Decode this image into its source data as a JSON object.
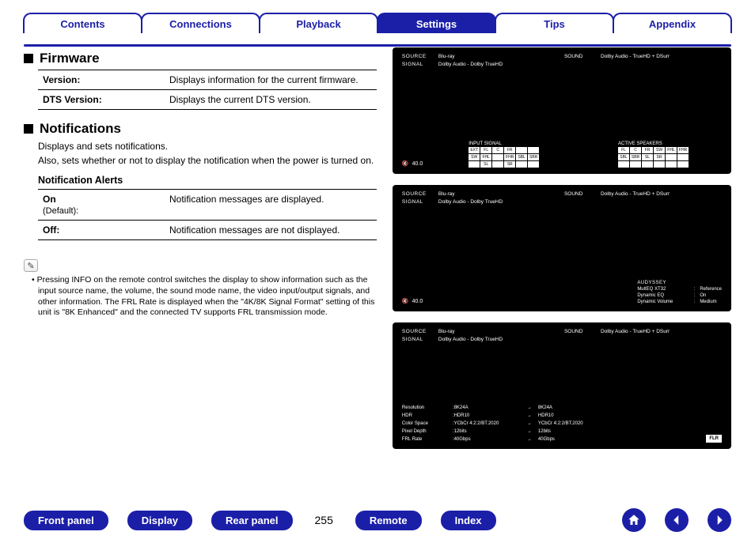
{
  "tabs": {
    "contents": "Contents",
    "connections": "Connections",
    "playback": "Playback",
    "settings": "Settings",
    "tips": "Tips",
    "appendix": "Appendix",
    "active": "settings"
  },
  "firmware": {
    "heading": "Firmware",
    "rows": [
      {
        "key": "Version:",
        "desc": "Displays information for the current firmware."
      },
      {
        "key": "DTS Version:",
        "desc": "Displays the current DTS version."
      }
    ]
  },
  "notifications": {
    "heading": "Notifications",
    "intro1": "Displays and sets notifications.",
    "intro2": "Also, sets whether or not to display the notification when the power is turned on.",
    "sub_heading": "Notification Alerts",
    "rows": [
      {
        "key": "On",
        "sub": "(Default):",
        "desc": "Notification messages are displayed."
      },
      {
        "key": "Off:",
        "sub": "",
        "desc": "Notification messages are not displayed."
      }
    ]
  },
  "note": {
    "icon_label": "pencil-icon",
    "text": "Pressing INFO on the remote control switches the display to show information such as the input source name, the volume, the sound mode name, the video input/output signals, and other information. The FRL Rate is displayed when the \"4K/8K Signal Format\" setting of this unit is \"8K Enhanced\" and the connected TV supports FRL transmission mode."
  },
  "osd": {
    "source_label": "SOURCE",
    "source_value": "Blu-ray",
    "signal_label": "SIGNAL",
    "signal_value": "Dolby Audio - Dolby TrueHD",
    "sound_label": "SOUND",
    "sound_value": "Dolby Audio - TrueHD + DSurr",
    "volume": "40.0",
    "panel1": {
      "input_signal_label": "INPUT SIGNAL",
      "active_speakers_label": "ACTIVE SPEAKERS",
      "cells": [
        "EXT",
        "FL",
        "C",
        "FR",
        "",
        "",
        "SW",
        "FHL",
        "",
        "FHR",
        "SBL",
        "SBR",
        "",
        "SL",
        "",
        "SR",
        "",
        "",
        ""
      ]
    },
    "panel2": {
      "audyssey_label": "AUDYSSEY",
      "rows": [
        {
          "k": "MultEQ XT32",
          "v": "Reference"
        },
        {
          "k": "Dynamic EQ",
          "v": "On"
        },
        {
          "k": "Dynamic Volume",
          "v": "Medium"
        }
      ]
    },
    "panel3": {
      "flr_box": "FLR",
      "rows": [
        {
          "k": "Resolution",
          "a": "8K24A",
          "b": "8K24A"
        },
        {
          "k": "HDR",
          "a": "HDR10",
          "b": "HDR10"
        },
        {
          "k": "Color Space",
          "a": "YCbCr 4:2:2/BT.2020",
          "b": "YCbCr 4:2:2/BT.2020"
        },
        {
          "k": "Pixel Depth",
          "a": "12bits",
          "b": "12bits"
        },
        {
          "k": "FRL Rate",
          "a": "40Gbps",
          "b": "40Gbps"
        }
      ]
    }
  },
  "footer": {
    "front_panel": "Front panel",
    "display": "Display",
    "rear_panel": "Rear panel",
    "page": "255",
    "remote": "Remote",
    "index": "Index"
  }
}
